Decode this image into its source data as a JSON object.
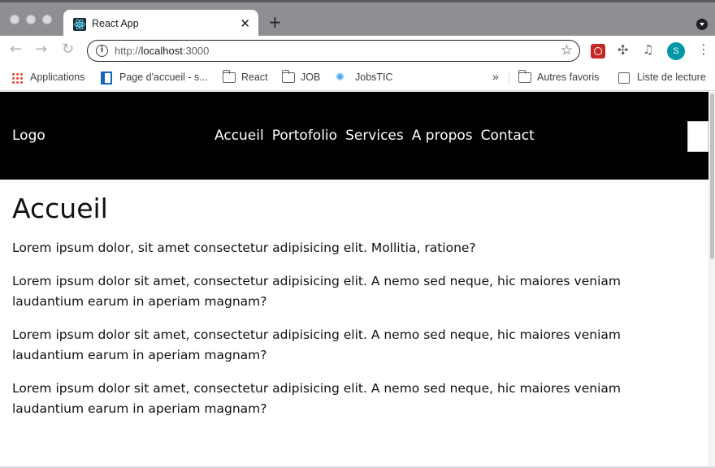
{
  "browser": {
    "tab_title": "React App",
    "tab_close": "✕",
    "new_tab": "+",
    "url_scheme": "http://",
    "url_host": "localhost",
    "url_port": ":3000",
    "profile_initial": "S",
    "bookmarks": {
      "apps": "Applications",
      "page_accueil": "Page d'accueil - s...",
      "react": "React",
      "job": "JOB",
      "jobstic": "JobsTIC",
      "more": "»",
      "autres_favoris": "Autres favoris",
      "liste_lecture": "Liste de lecture"
    }
  },
  "site": {
    "logo": "Logo",
    "nav": {
      "accueil": "Accueil",
      "portofolio": "Portofolio",
      "services": "Services",
      "apropos": "A propos",
      "contact": "Contact"
    },
    "heading": "Accueil",
    "paragraphs": [
      "Lorem ipsum dolor, sit amet consectetur adipisicing elit. Mollitia, ratione?",
      "Lorem ipsum dolor sit amet, consectetur adipisicing elit. A nemo sed neque, hic maiores veniam laudantium earum in aperiam magnam?",
      "Lorem ipsum dolor sit amet, consectetur adipisicing elit. A nemo sed neque, hic maiores veniam laudantium earum in aperiam magnam?",
      "Lorem ipsum dolor sit amet, consectetur adipisicing elit. A nemo sed neque, hic maiores veniam laudantium earum in aperiam magnam?"
    ]
  },
  "colors": {
    "header_bg": "#000000",
    "header_text": "#ffffff",
    "tabbar_bg": "#8e8e93",
    "profile_bg": "#0097a7"
  }
}
